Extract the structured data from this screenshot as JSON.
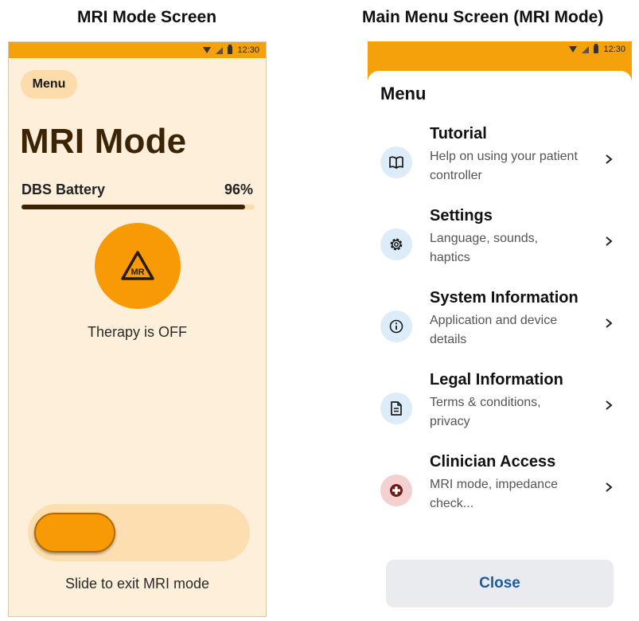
{
  "captions": {
    "left": "MRI Mode Screen",
    "right": "Main Menu Screen (MRI Mode)"
  },
  "status_bar": {
    "time": "12:30"
  },
  "mri_screen": {
    "menu_button": "Menu",
    "title": "MRI Mode",
    "battery_label": "DBS Battery",
    "battery_value": "96%",
    "battery_level_percent": 96,
    "icon_text": "MR",
    "therapy_status": "Therapy is OFF",
    "slider_label": "Slide to exit MRI mode"
  },
  "menu_screen": {
    "title": "Menu",
    "items": [
      {
        "title": "Tutorial",
        "description": "Help on using your patient controller",
        "icon": "book-icon"
      },
      {
        "title": "Settings",
        "description": "Language, sounds, haptics",
        "icon": "gear-icon"
      },
      {
        "title": "System Information",
        "description": "Application and device details",
        "icon": "info-icon"
      },
      {
        "title": "Legal Information",
        "description": "Terms & conditions, privacy",
        "icon": "document-icon"
      },
      {
        "title": "Clinician Access",
        "description": "MRI mode, impedance check...",
        "icon": "medical-cross-icon"
      }
    ],
    "close_button": "Close"
  },
  "colors": {
    "accent_orange": "#f79a06",
    "status_bar_orange": "#f5a10b",
    "screen_background": "#fdefd9",
    "title_brown": "#3b2406",
    "close_text_blue": "#1d5a9b",
    "icon_bg_blue": "#dcecf9",
    "icon_bg_red": "#f4d0d0"
  }
}
